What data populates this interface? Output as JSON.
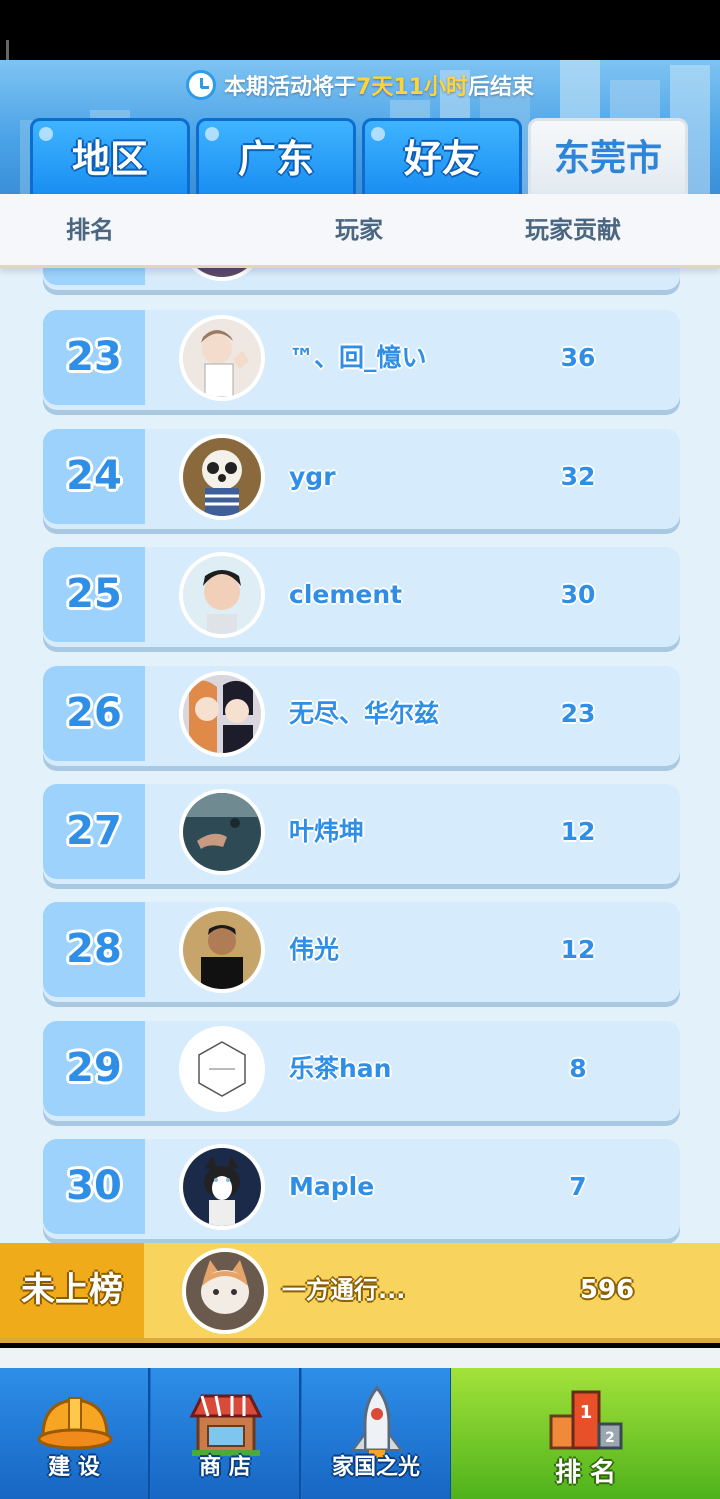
{
  "banner": {
    "prefix": "本期活动将于",
    "remaining": "7天11小时",
    "suffix": "后结束"
  },
  "tabs": [
    {
      "label": "地区",
      "active": false
    },
    {
      "label": "广东",
      "active": false
    },
    {
      "label": "好友",
      "active": false
    },
    {
      "label": "东莞市",
      "active": true
    }
  ],
  "columns": {
    "rank": "排名",
    "player": "玩家",
    "contribution": "玩家贡献"
  },
  "rows": [
    {
      "rank": "23",
      "name": "™、回_憶い",
      "score": "36",
      "avatar": "anime-boy-avatar"
    },
    {
      "rank": "24",
      "name": "ygr",
      "score": "32",
      "avatar": "panda-dog-avatar"
    },
    {
      "rank": "25",
      "name": "clement",
      "score": "30",
      "avatar": "young-man-avatar"
    },
    {
      "rank": "26",
      "name": "无尽、华尔兹",
      "score": "23",
      "avatar": "anime-couple-avatar"
    },
    {
      "rank": "27",
      "name": "叶炜坤",
      "score": "12",
      "avatar": "underwater-hand-avatar"
    },
    {
      "rank": "28",
      "name": "伟光",
      "score": "12",
      "avatar": "man-portrait-avatar"
    },
    {
      "rank": "29",
      "name": "乐茶han",
      "score": "8",
      "avatar": "lecha-logo-avatar"
    },
    {
      "rank": "30",
      "name": "Maple",
      "score": "7",
      "avatar": "husky-avatar"
    }
  ],
  "me": {
    "label": "未上榜",
    "name": "一方通行...",
    "score": "596",
    "avatar": "cat-avatar"
  },
  "nav": [
    {
      "label": "建 设",
      "icon": "hardhat-icon",
      "active": false
    },
    {
      "label": "商 店",
      "icon": "shop-icon",
      "active": false
    },
    {
      "label": "家国之光",
      "icon": "rocket-icon",
      "active": false
    },
    {
      "label": "排 名",
      "icon": "podium-icon",
      "active": true
    }
  ],
  "colors": {
    "accent": "#2f8ee6",
    "tab": "#1a8ef2",
    "me_bar": "#f8d35e",
    "nav_active": "#7cc82a"
  }
}
